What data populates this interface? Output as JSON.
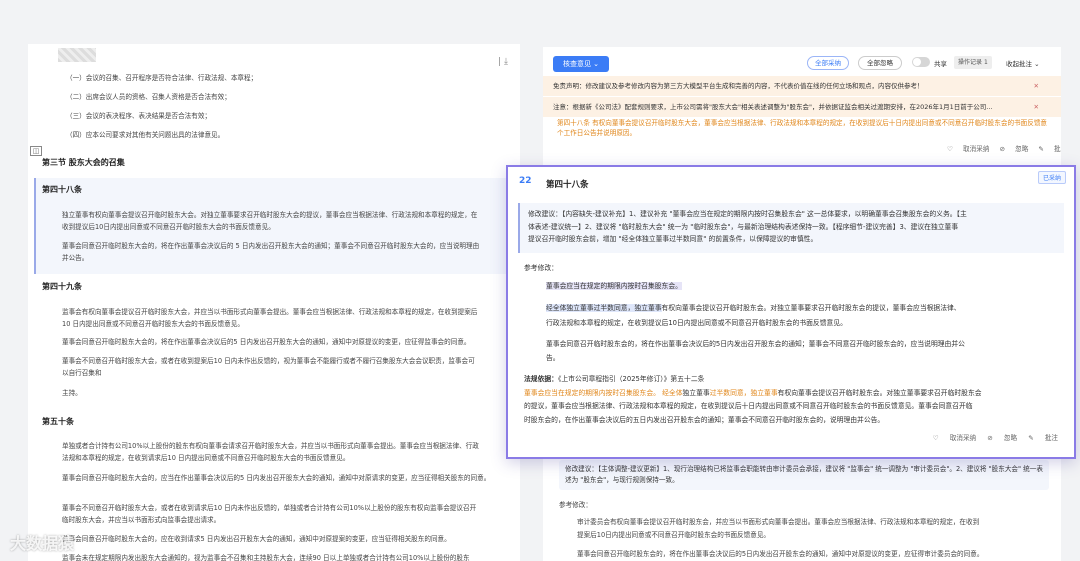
{
  "left": {
    "tool_label": "| ⤓",
    "items": [
      "（一）会议的召集、召开程序是否符合法律、行政法规、本章程；",
      "（二）出席会议人员的资格、召集人资格是否合法有效；",
      "（三）会议的表决程序、表决结果是否合法有效；",
      "（四）应本公司要求对其他有关问题出具的法律意见。"
    ],
    "section": "第三节 股东大会的召集",
    "art48_title": "第四十八条",
    "art48_p1": "独立董事有权向董事会提议召开临时股东大会。对独立董事要求召开临时股东大会的提议，董事会应当根据法律、行政法规和本章程的规定，在",
    "art48_p1b": "收到提议后10日内提出同意或不同意召开临时股东大会的书面反馈意见。",
    "art48_p2": "董事会同意召开临时股东大会的，将在作出董事会决议后的 5 日内发出召开股东大会的通知；董事会不同意召开临时股东大会的，应当说明理由",
    "art48_p2b": "并公告。",
    "art49_title": "第四十九条",
    "art49_p1": "监事会有权向董事会提议召开临时股东大会，并应当以书面形式向董事会提出。董事会应当根据法律、行政法规和本章程的规定，在收到提案后",
    "art49_p1b": "10 日内提出同意或不同意召开临时股东大会的书面反馈意见。",
    "art49_p2": "董事会同意召开临时股东大会的，将在作出董事会决议后的5 日内发出召开股东大会的通知，通知中对原提议的变更，应征得监事会的同意。",
    "art49_p3": "董事会不同意召开临时股东大会，或者在收到提案后10 日内未作出反馈的，视为董事会不能履行或者不履行召集股东大会会议职责，监事会可",
    "art49_p3b": "以自行召集和",
    "art49_p4": "主持。",
    "art50_title": "第五十条",
    "art50_p1": "单独或者合计持有公司10%以上股份的股东有权向董事会请求召开临时股东大会，并应当以书面形式向董事会提出。董事会应当根据法律、行政",
    "art50_p1b": "法规和本章程的规定，在收到请求后10 日内提出同意或不同意召开临时股东大会的书面反馈意见。",
    "art50_p2": "董事会同意召开临时股东大会的，应当在作出董事会决议后的5 日内发出召开股东大会的通知，通知中对原请求的变更，应当征得相关股东的同意。",
    "art50_p3": "董事会不同意召开临时股东大会，或者在收到请求后10 日内未作出反馈的，单独或者合计持有公司10%以上股份的股东有权向监事会提议召开",
    "art50_p3b": "临时股东大会，并应当以书面形式向监事会提出请求。",
    "art50_p4": "监事会同意召开临时股东大会的，应在收到请求5 日内发出召开股东大会的通知，通知中对原提案的变更，应当征得相关股东的同意。",
    "art50_p5": "监事会未在规定期限内发出股东大会通知的，视为监事会不召集和主持股东大会，连续90 日以上单独或者合计持有公司10%以上股份的股东"
  },
  "right": {
    "review_btn": "核查意见 ⌄",
    "accept_all": "全部采纳",
    "ignore_all": "全部忽略",
    "share": "共享",
    "log": "操作记录",
    "log_count": "1",
    "collapse": "收起批注 ⌄",
    "notice1": "免责声明：修改建议及参考修改内容为第三方大模型平台生成和完善的内容，不代表价值在线的任何立场和观点，内容仅供参考！",
    "notice2": "注意：根据新《公司法》配套规则要求，上市公司需将\"股东大会\"相关表述调整为\"股东会\"，并依据证监会相关过渡期安排，在2026年1月1日前于公司...",
    "orange1": "第四十八条 有权向董事会提议召开临时股东大会，董事会应当根据法律、行政法规和本章程的规定，在收到提议后十日内提出同意或不同意召开临时股东会的书面反馈意见。",
    "orange2": "个工作日公告并说明原因。",
    "actions": [
      "取消采纳",
      "忽略",
      "批注"
    ],
    "bottom_box": "修改建议：【主体调整-建议更新】1、现行治理结构已将监事会职能转由审计委员会承接，建议将 \"监事会\" 统一调整为 \"审计委员会\"。2、建议将 \"股东大会\" 统一表述为 \"股东会\"，与现行规则保持一致。",
    "ref_label": "参考修改：",
    "bottom_p1": "审计委员会有权向董事会提议召开临时股东会，并应当以书面形式向董事会提出。董事会应当根据法律、行政法规和本章程的规定，在收到",
    "bottom_p1b": "提案后10日内提出同意或不同意召开临时股东会的书面反馈意见。",
    "bottom_p2": "董事会同意召开临时股东会的，将在作出董事会决议后的5日内发出召开股东会的通知，通知中对原提议的变更，应征得审计委员会的同意。"
  },
  "card": {
    "num": "22",
    "title": "第四十八条",
    "badge": "已采纳",
    "suggestion_l1": "修改建议：【内容缺失-建议补充】1、建议补充 \"董事会应当在规定的期限内按时召集股东会\" 这一总体要求，以明确董事会召集股东会的义务。【主",
    "suggestion_l2": "体表述-建议统一】2、建议将 \"临时股东大会\" 统一为 \"临时股东会\"，与最新治理结构表述保持一致。【程序细节-建议完善】3、建议在独立董事",
    "suggestion_l3": "提议召开临时股东会前，增加 \"经全体独立董事过半数同意\" 的前置条件，以保障提议的审慎性。",
    "ref_label": "参考修改：",
    "p1": "董事会应当在规定的期限内按时召集股东会。",
    "p2a": "经全体独立董事过半数同意，独立董事",
    "p2b": "有权向董事会提议召开临时股东会。对独立董事要求召开临时股东会的提议，董事会应当根据法律、",
    "p2c": "行政法规和本章程的规定，在收到提议后10日内提出同意或不同意召开临时股东会的书面反馈意见。",
    "p3a": "董事会同意召开临时股东会的，将在作出董事会决议后的5日内发出召开股东会的通知；董事会不同意召开临时股东会的，应当说明理由并公",
    "p3b": "告。",
    "law_label": "法规依据：",
    "law_ref": "《上市公司章程指引（2025年修订）》第五十二条",
    "law_o1": "董事会应当在规定的期限内按时召集股东会。",
    "law_o2": "经全体",
    "law_t1": "独立董事",
    "law_o3": "过半数同意，独立董事",
    "law_t2": "有权向董事会提议召开临时股东会。对独立董事要求召开临时股东会",
    "law_t3": "的提议，董事会应当根据法律、行政法规和本章程的规定，在收到提议后十日内提出同意或不同意召开临时股东会的书面反馈意见。董事会同意召开临",
    "law_t4": "时股东会的，在作出董事会决议后的五日内发出召开股东会的通知；董事会不同意召开临时股东会的，说明理由并公告。",
    "actions": [
      "取消采纳",
      "忽略",
      "批注"
    ]
  },
  "watermark": "大数据猿"
}
